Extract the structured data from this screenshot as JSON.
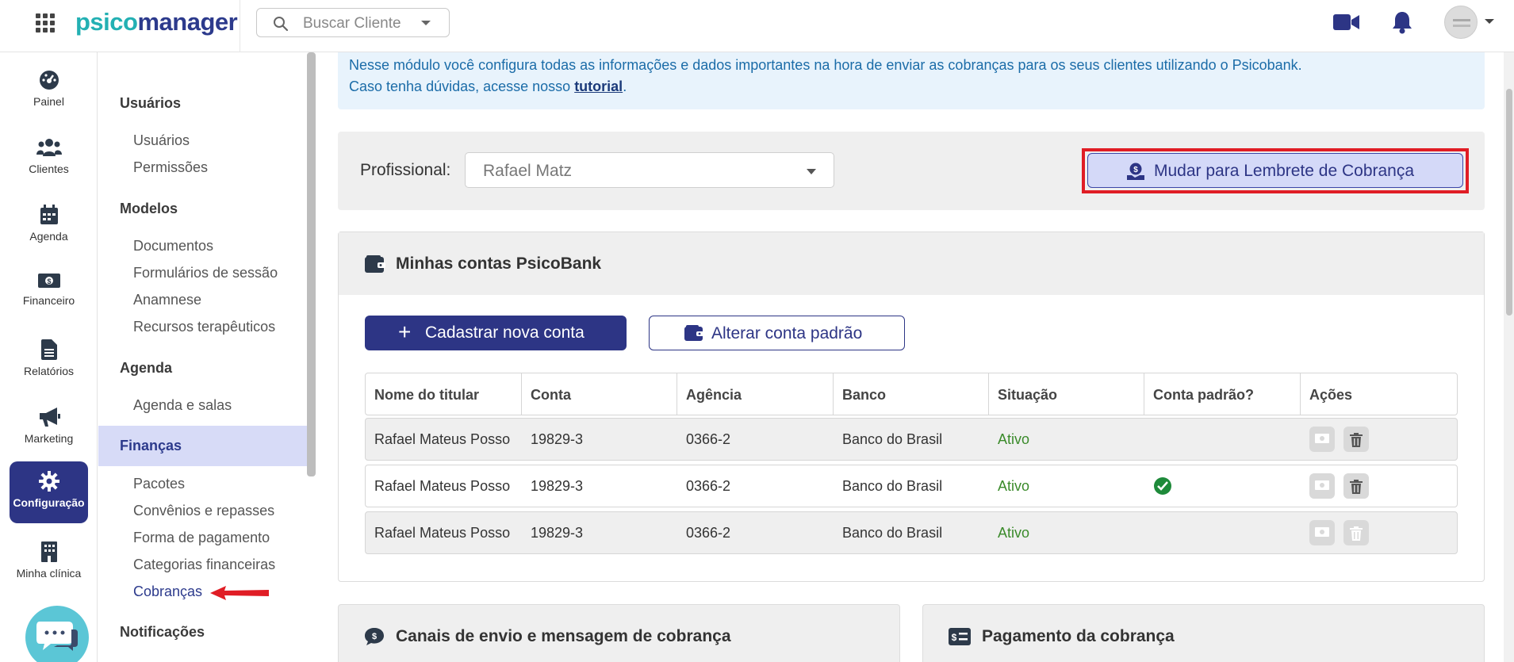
{
  "header": {
    "logo_part1": "psico",
    "logo_part2": "manager",
    "search_placeholder": "Buscar Cliente",
    "icons": [
      "apps-grid-icon",
      "search-icon",
      "video-camera-icon",
      "bell-icon",
      "user-avatar"
    ]
  },
  "rail": {
    "items": [
      {
        "label": "Painel",
        "icon": "dashboard-gauge-icon"
      },
      {
        "label": "Clientes",
        "icon": "users-group-icon"
      },
      {
        "label": "Agenda",
        "icon": "calendar-icon"
      },
      {
        "label": "Financeiro",
        "icon": "money-bill-icon"
      },
      {
        "label": "Relatórios",
        "icon": "document-icon"
      },
      {
        "label": "Marketing",
        "icon": "megaphone-icon"
      },
      {
        "label": "Configuração",
        "icon": "gear-icon",
        "active": true
      },
      {
        "label": "Minha clínica",
        "icon": "building-icon"
      }
    ]
  },
  "submenu": {
    "sections": [
      {
        "title": "Usuários",
        "links": [
          "Usuários",
          "Permissões"
        ]
      },
      {
        "title": "Modelos",
        "links": [
          "Documentos",
          "Formulários de sessão",
          "Anamnese",
          "Recursos terapêuticos"
        ]
      },
      {
        "title": "Agenda",
        "links": [
          "Agenda e salas"
        ]
      },
      {
        "title": "Finanças",
        "links": [
          "Pacotes",
          "Convênios e repasses",
          "Forma de pagamento",
          "Categorias financeiras",
          "Cobranças"
        ],
        "active": true
      },
      {
        "title": "Notificações",
        "links": []
      }
    ],
    "current_link": "Cobranças"
  },
  "info": {
    "line1": "Nesse módulo você configura todas as informações e dados importantes na hora de enviar as cobranças para os seus clientes utilizando o Psicobank.",
    "line2_prefix": "Caso tenha dúvidas, acesse nosso ",
    "line2_link": "tutorial",
    "line2_suffix": "."
  },
  "professional": {
    "label": "Profissional:",
    "selected": "Rafael Matz",
    "switch_button": "Mudar para Lembrete de Cobrança"
  },
  "accounts": {
    "title": "Minhas contas PsicoBank",
    "new_button": "Cadastrar nova conta",
    "change_default_button": "Alterar conta padrão",
    "columns": [
      "Nome do titular",
      "Conta",
      "Agência",
      "Banco",
      "Situação",
      "Conta padrão?",
      "Ações"
    ],
    "rows": [
      {
        "titular": "Rafael Mateus Posso",
        "conta": "19829-3",
        "agencia": "0366-2",
        "banco": "Banco do Brasil",
        "situacao": "Ativo",
        "padrao": false
      },
      {
        "titular": "Rafael Mateus Posso",
        "conta": "19829-3",
        "agencia": "0366-2",
        "banco": "Banco do Brasil",
        "situacao": "Ativo",
        "padrao": true
      },
      {
        "titular": "Rafael Mateus Posso",
        "conta": "19829-3",
        "agencia": "0366-2",
        "banco": "Banco do Brasil",
        "situacao": "Ativo",
        "padrao": false
      }
    ]
  },
  "bottom_cards": {
    "channels_title": "Canais de envio e mensagem de cobrança",
    "payment_title": "Pagamento da cobrança"
  },
  "colors": {
    "brand_primary": "#2d3585",
    "brand_teal": "#23b0b3",
    "status_active": "#3a8a2a",
    "highlight": "#e01d25"
  }
}
